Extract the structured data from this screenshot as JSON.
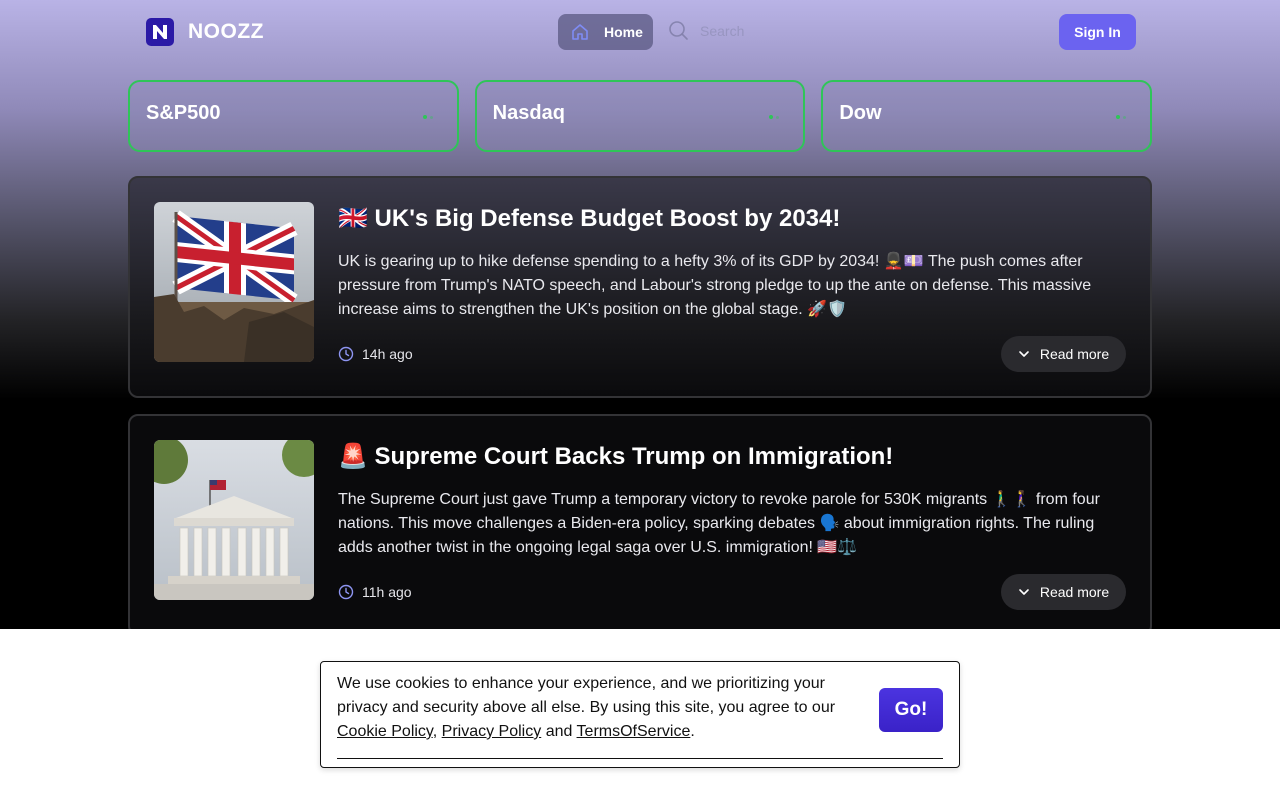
{
  "header": {
    "logo_text": "NOOZZ",
    "home_label": "Home",
    "search_placeholder": "Search",
    "signin_label": "Sign In"
  },
  "tickers": [
    {
      "name": "S&P500"
    },
    {
      "name": "Nasdaq"
    },
    {
      "name": "Dow"
    }
  ],
  "articles": [
    {
      "title": "🇬🇧 UK's Big Defense Budget Boost by 2034!",
      "body": "UK is gearing up to hike defense spending to a hefty 3% of its GDP by 2034! 💂‍♂️💷 The push comes after pressure from Trump's NATO speech, and Labour's strong pledge to up the ante on defense. This massive increase aims to strengthen the UK's position on the global stage. 🚀🛡️",
      "time": "14h ago",
      "read_more": "Read more"
    },
    {
      "title": "🚨 Supreme Court Backs Trump on Immigration!",
      "body": "The Supreme Court just gave Trump a temporary victory to revoke parole for 530K migrants 🚶‍♂️🚶‍♀️ from four nations. This move challenges a Biden-era policy, sparking debates 🗣️ about immigration rights. The ruling adds another twist in the ongoing legal saga over U.S. immigration! 🇺🇸⚖️",
      "time": "11h ago",
      "read_more": "Read more"
    }
  ],
  "cookie": {
    "text": "We use cookies to enhance your experience, and we prioritizing your privacy and security above all else. By using this site, you agree to our",
    "cookie_policy": "Cookie Policy",
    "separator": ",",
    "privacy_policy": "Privacy Policy",
    "and": "and",
    "terms": "TermsOfService",
    "period": ".",
    "button": "Go!"
  },
  "colors": {
    "accent": "#6b63f0",
    "ticker_border": "#2fc558",
    "go_button": "#3a22c8"
  }
}
